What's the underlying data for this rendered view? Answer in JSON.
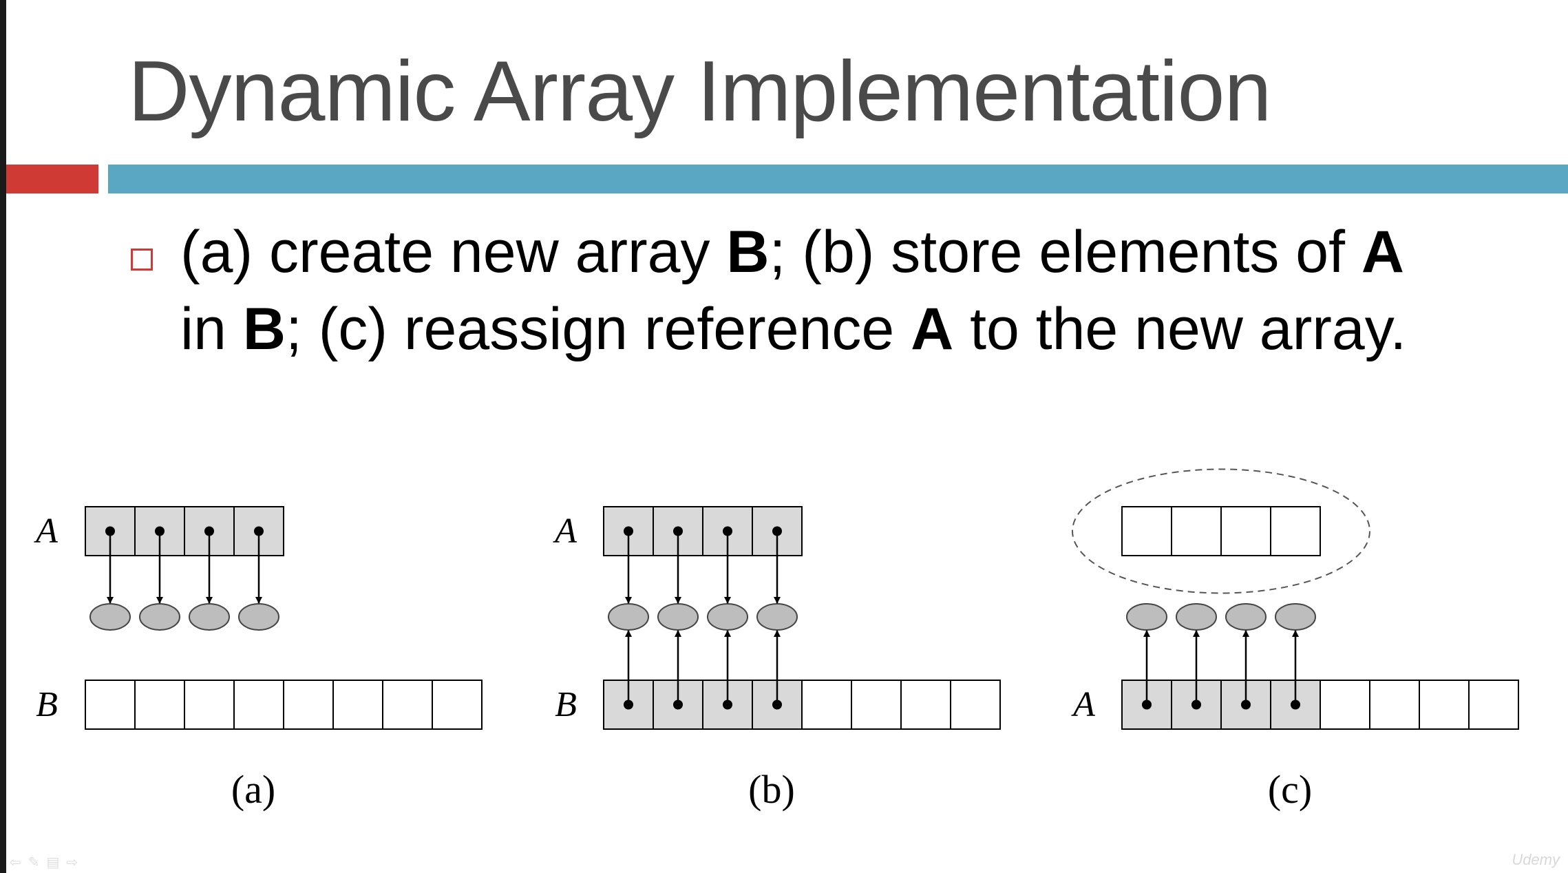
{
  "slide": {
    "title": "Dynamic Array Implementation",
    "bullet": {
      "line1": [
        "(a) create new array ",
        "B",
        "; (b) store elements of ",
        "A"
      ],
      "line2": [
        "in ",
        "B",
        "; (c) reassign reference ",
        "A",
        " to the new array."
      ]
    }
  },
  "diagrams": [
    {
      "caption": "(a)",
      "top_label": "A",
      "bottom_label": "B",
      "top_cells": 4,
      "bottom_cells": 8,
      "filled_top_cells": 4,
      "filled_bottom_cells": 0,
      "arrows": "down",
      "old_array_circled": false
    },
    {
      "caption": "(b)",
      "top_label": "A",
      "bottom_label": "B",
      "top_cells": 4,
      "bottom_cells": 8,
      "filled_top_cells": 4,
      "filled_bottom_cells": 4,
      "arrows": "both",
      "old_array_circled": false
    },
    {
      "caption": "(c)",
      "top_label": "",
      "bottom_label": "A",
      "top_cells": 4,
      "bottom_cells": 8,
      "filled_top_cells": 0,
      "filled_bottom_cells": 4,
      "arrows": "up",
      "old_array_circled": true
    }
  ],
  "colors": {
    "title_text": "#4a4a4a",
    "accent_red": "#cf3a34",
    "accent_blue": "#5aa7c4",
    "cell_fill": "#d9d9d9",
    "element_fill": "#bdbdbd"
  },
  "footer": {
    "nav_icons": [
      "prev-arrow-icon",
      "pen-icon",
      "menu-icon",
      "next-arrow-icon"
    ],
    "brand_logo": "udemy-logo"
  }
}
